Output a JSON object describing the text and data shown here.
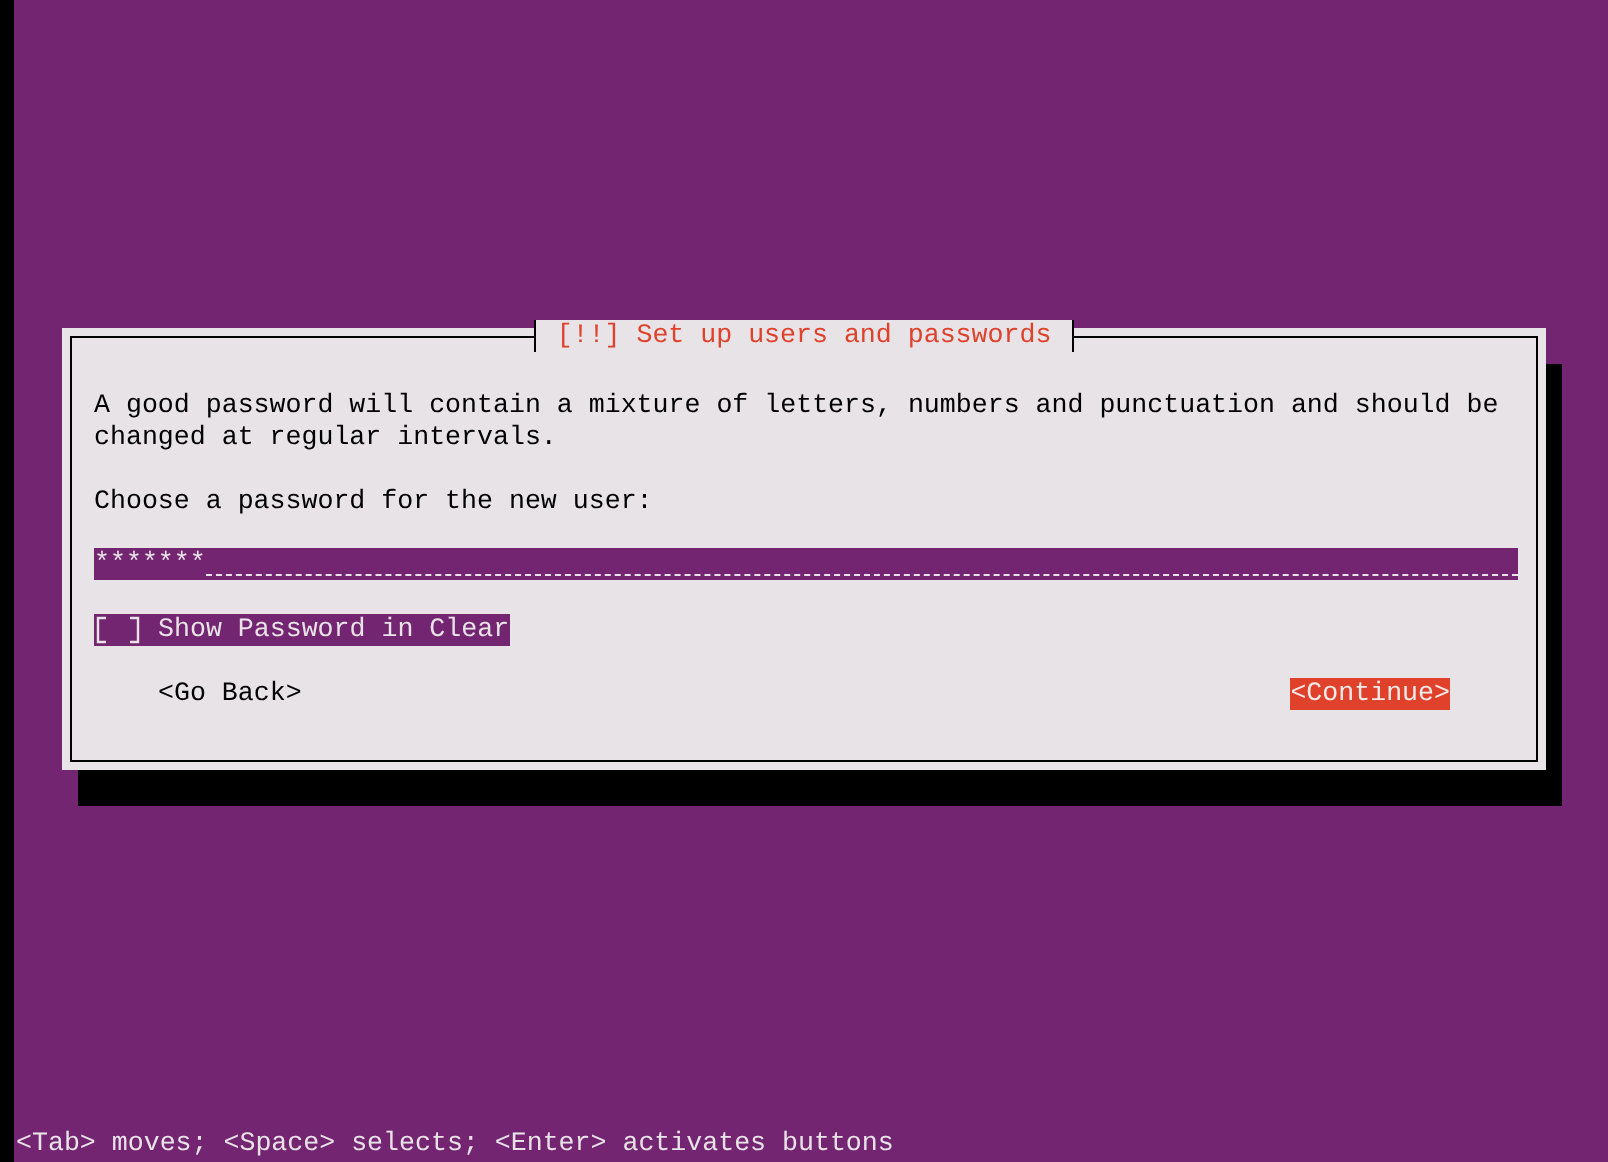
{
  "dialog": {
    "title": "[!!] Set up users and passwords",
    "message": "A good password will contain a mixture of letters, numbers and punctuation and should be changed at regular intervals.",
    "prompt": "Choose a password for the new user:",
    "password_field": {
      "value": "*******",
      "focused": true
    },
    "checkbox": {
      "label": "Show Password in Clear",
      "checked": false,
      "focused": true
    },
    "buttons": [
      {
        "label": "<Go Back>",
        "selected": false
      },
      {
        "label": "<Continue>",
        "selected": true
      }
    ]
  },
  "status_bar": "<Tab> moves; <Space> selects; <Enter> activates buttons"
}
